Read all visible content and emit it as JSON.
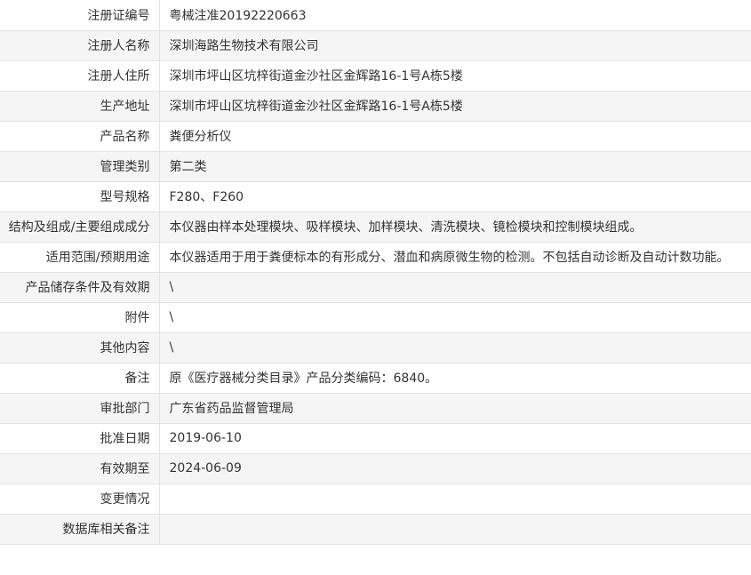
{
  "rows": [
    {
      "label": "注册证编号",
      "value": "粤械注准20192220663"
    },
    {
      "label": "注册人名称",
      "value": "深圳海路生物技术有限公司"
    },
    {
      "label": "注册人住所",
      "value": "深圳市坪山区坑梓街道金沙社区金辉路16-1号A栋5楼"
    },
    {
      "label": "生产地址",
      "value": "深圳市坪山区坑梓街道金沙社区金辉路16-1号A栋5楼"
    },
    {
      "label": "产品名称",
      "value": "粪便分析仪"
    },
    {
      "label": "管理类别",
      "value": "第二类"
    },
    {
      "label": "型号规格",
      "value": "F280、F260"
    },
    {
      "label": "结构及组成/主要组成成分",
      "value": "本仪器由样本处理模块、吸样模块、加样模块、清洗模块、镜检模块和控制模块组成。"
    },
    {
      "label": "适用范围/预期用途",
      "value": "本仪器适用于用于粪便标本的有形成分、潜血和病原微生物的检测。不包括自动诊断及自动计数功能。"
    },
    {
      "label": "产品储存条件及有效期",
      "value": "\\"
    },
    {
      "label": "附件",
      "value": "\\"
    },
    {
      "label": "其他内容",
      "value": "\\"
    },
    {
      "label": "备注",
      "value": "原《医疗器械分类目录》产品分类编码：6840。"
    },
    {
      "label": "审批部门",
      "value": "广东省药品监督管理局"
    },
    {
      "label": "批准日期",
      "value": "2019-06-10"
    },
    {
      "label": "有效期至",
      "value": "2024-06-09"
    },
    {
      "label": "变更情况",
      "value": ""
    },
    {
      "label": "数据库相关备注",
      "value": ""
    }
  ]
}
